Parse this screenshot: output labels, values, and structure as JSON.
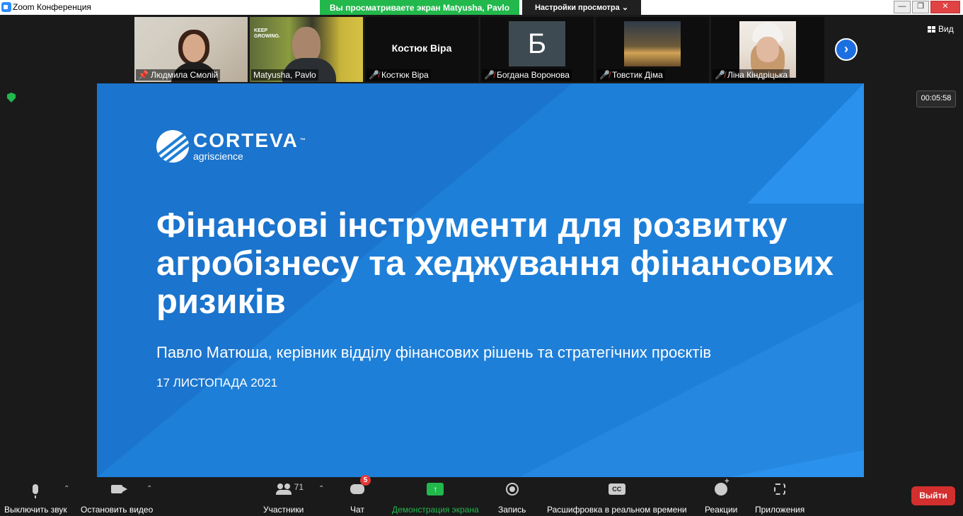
{
  "window": {
    "title": "Zoom Конференция"
  },
  "header": {
    "share_banner": "Вы просматриваете экран Matyusha, Pavlo",
    "view_options": "Настройки просмотра ⌄"
  },
  "gallery": {
    "tiles": [
      {
        "name": "Людмила Смолій",
        "pinned": true
      },
      {
        "name": "Matyusha, Pavlo"
      },
      {
        "name": "Костюк Віра",
        "center_label": "Костюк Віра",
        "muted": true
      },
      {
        "name": "Богдана Воронова",
        "avatar_letter": "Б",
        "muted": true
      },
      {
        "name": "Товстик Діма",
        "muted": true
      },
      {
        "name": "Ліна Кіндріцька",
        "muted": true
      }
    ],
    "next_icon": "chevron-right-icon",
    "view_label": "Вид"
  },
  "meeting": {
    "timer": "00:05:58",
    "security_icon": "shield-icon"
  },
  "slide": {
    "logo_name": "CORTEVA",
    "logo_tm": "™",
    "logo_sub": "agriscience",
    "title": "Фінансові інструменти для розвитку агробізнесу та хеджування фінансових ризиків",
    "subtitle": "Павло Матюша, керівник відділу фінансових рішень та стратегічних проєктів",
    "date": "17 ЛИСТОПАДА 2021",
    "bg_color": "#1e7fd8"
  },
  "toolbar": {
    "mute": "Выключить звук",
    "video": "Остановить видео",
    "participants": "Участники",
    "participants_count": "71",
    "chat": "Чат",
    "chat_badge": "5",
    "share": "Демонстрация экрана",
    "record": "Запись",
    "transcript": "Расшифровка в реальном времени",
    "cc": "CC",
    "reactions": "Реакции",
    "apps": "Приложения",
    "leave": "Выйти"
  },
  "colors": {
    "accent_green": "#22b84c",
    "leave_red": "#d32f2f",
    "zoom_blue": "#2d8cff"
  }
}
